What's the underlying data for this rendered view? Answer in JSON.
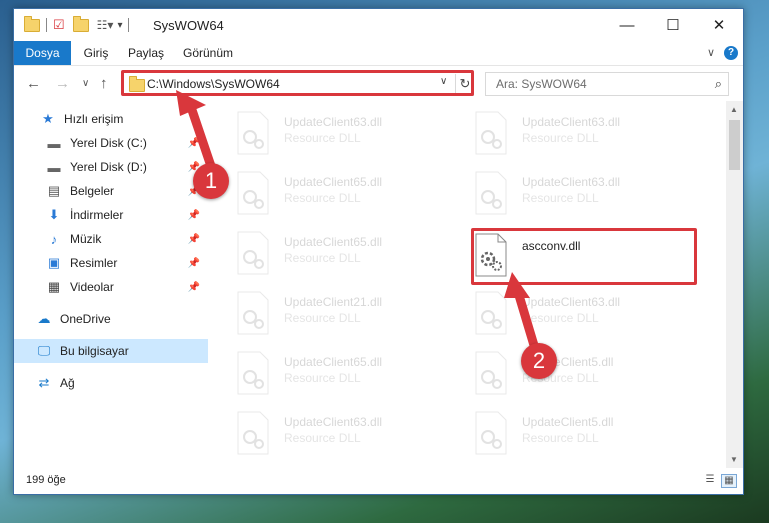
{
  "window": {
    "title": "SysWOW64"
  },
  "ribbon": {
    "tabs": [
      "Dosya",
      "Giriş",
      "Paylaş",
      "Görünüm"
    ],
    "active_tab": "Dosya"
  },
  "navigation": {
    "address": "C:\\Windows\\SysWOW64",
    "search_placeholder": "Ara: SysWOW64"
  },
  "sidebar": {
    "items": [
      {
        "label": "Hızlı erişim",
        "icon": "star-icon"
      },
      {
        "label": "Yerel Disk (C:)",
        "icon": "drive-icon"
      },
      {
        "label": "Yerel Disk (D:)",
        "icon": "drive-icon"
      },
      {
        "label": "Belgeler",
        "icon": "documents-icon"
      },
      {
        "label": "İndirmeler",
        "icon": "download-icon"
      },
      {
        "label": "Müzik",
        "icon": "music-icon"
      },
      {
        "label": "Resimler",
        "icon": "pictures-icon"
      },
      {
        "label": "Videolar",
        "icon": "video-icon"
      },
      {
        "label": "OneDrive",
        "icon": "cloud-icon"
      },
      {
        "label": "Bu bilgisayar",
        "icon": "computer-icon"
      },
      {
        "label": "Ağ",
        "icon": "network-icon"
      }
    ],
    "selected": "Bu bilgisayar"
  },
  "files": {
    "left_column": [
      {
        "name": "UpdateClient63.dll",
        "desc": "Resource DLL"
      },
      {
        "name": "UpdateClient65.dll",
        "desc": "Resource DLL"
      },
      {
        "name": "UpdateClient65.dll",
        "desc": "Resource DLL"
      },
      {
        "name": "UpdateClient21.dll",
        "desc": "Resource DLL"
      },
      {
        "name": "UpdateClient65.dll",
        "desc": "Resource DLL"
      },
      {
        "name": "UpdateClient63.dll",
        "desc": "Resource DLL"
      }
    ],
    "right_column": [
      {
        "name": "UpdateClient63.dll",
        "desc": "Resource DLL"
      },
      {
        "name": "UpdateClient63.dll",
        "desc": "Resource DLL"
      },
      {
        "name": "ascconv.dll",
        "desc": ""
      },
      {
        "name": "UpdateClient63.dll",
        "desc": "Resource DLL"
      },
      {
        "name": "UpdateClient5.dll",
        "desc": "Resource DLL"
      },
      {
        "name": "UpdateClient5.dll",
        "desc": "Resource DLL"
      }
    ]
  },
  "status": {
    "item_count": "199 öğe"
  },
  "annotations": {
    "step1": "1",
    "step2": "2",
    "highlight_color": "#d9373c"
  }
}
